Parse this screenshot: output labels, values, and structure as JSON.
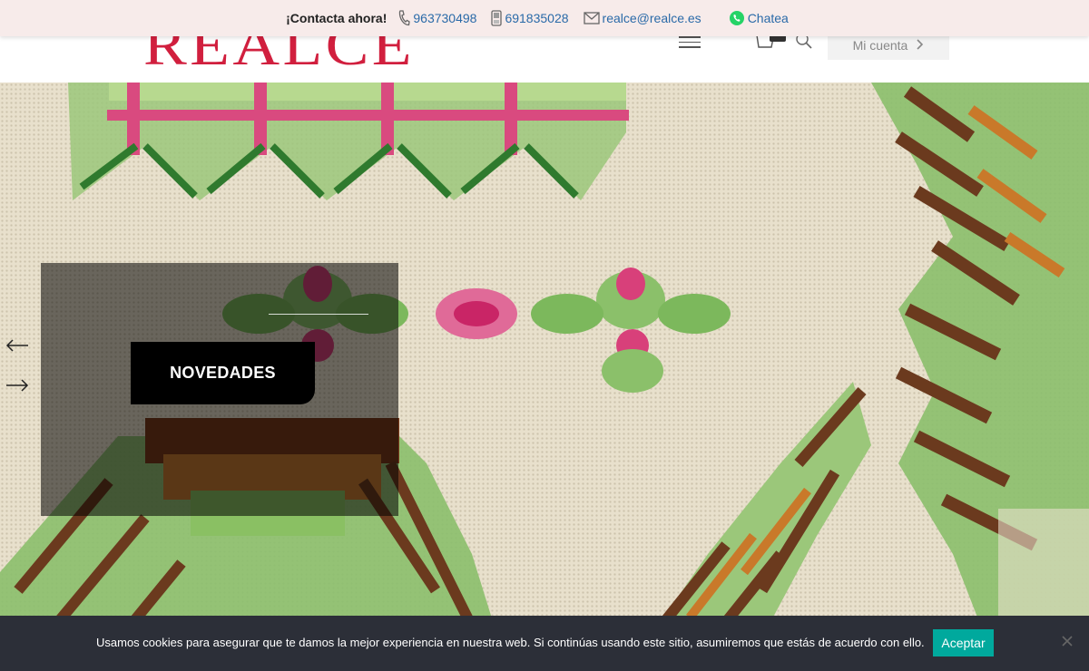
{
  "topbar": {
    "lead": "¡Contacta ahora!",
    "phone1": "963730498",
    "phone2": "691835028",
    "email": "realce@realce.es",
    "whatsapp": "Chatea"
  },
  "header": {
    "logo": "REALCE",
    "account_label": "Mi cuenta"
  },
  "hero": {
    "button_label": "NOVEDADES"
  },
  "cookie": {
    "message": "Usamos cookies para asegurar que te damos la mejor experiencia en nuestra web. Si continúas usando este sitio, asumiremos que estás de acuerdo con ello.",
    "accept_label": "Aceptar"
  },
  "colors": {
    "logo": "#d11f3e",
    "topbar_bg": "#f7ebea",
    "link": "#2a6aa8",
    "accept_bg": "#00a99d",
    "cookie_bg": "#2c2f38"
  },
  "icons": [
    "phone-icon",
    "mobile-icon",
    "mail-icon",
    "whatsapp-icon",
    "menu-icon",
    "cart-icon",
    "search-icon",
    "chevron-right-icon",
    "arrow-left-icon",
    "arrow-right-icon",
    "close-icon"
  ]
}
